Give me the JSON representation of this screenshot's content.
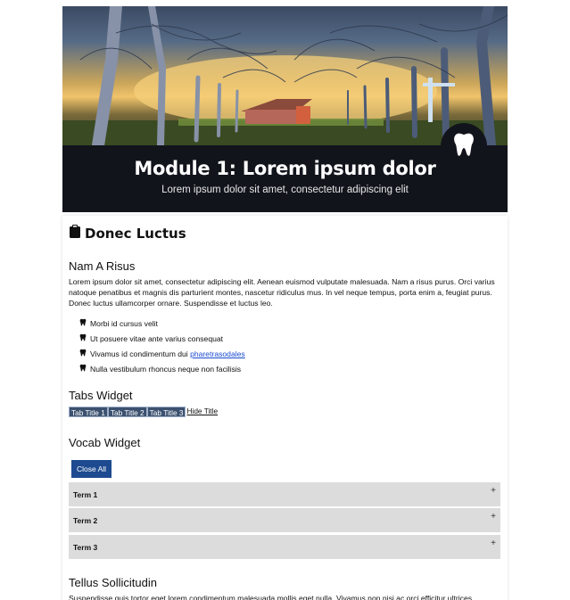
{
  "header": {
    "title": "Module 1: Lorem ipsum dolor",
    "subtitle": "Lorem ipsum dolor sit amet, consectetur adipiscing elit",
    "badge_icon": "tooth-icon"
  },
  "section": {
    "heading": "Donec Luctus",
    "heading_icon": "clipboard-icon"
  },
  "intro": {
    "title": "Nam A Risus",
    "paragraph": "Lorem ipsum dolor sit amet, consectetur adipiscing elit. Aenean euismod vulputate malesuada. Nam a risus purus. Orci varius natoque penatibus et magnis dis parturient montes, nascetur ridiculus mus. In vel neque tempus, porta enim a, feugiat purus. Donec luctus ullamcorper ornare. Suspendisse et luctus leo.",
    "bullets": [
      {
        "text": "Morbi id cursus velit"
      },
      {
        "text": "Ut posuere vitae ante varius consequat"
      },
      {
        "text": "Vivamus id condimentum dui ",
        "link": "pharetrasodales"
      },
      {
        "text": "Nulla vestibulum rhoncus neque non facilisis"
      }
    ],
    "bullet_icon": "tooth-icon"
  },
  "tabs_widget": {
    "title": "Tabs Widget",
    "tabs": [
      "Tab Title 1",
      "Tab Title 2",
      "Tab Title 3"
    ],
    "hide_label": "Hide Title"
  },
  "vocab_widget": {
    "title": "Vocab Widget",
    "close_all_label": "Close All",
    "terms": [
      "Term 1",
      "Term 2",
      "Term 3"
    ],
    "expand_symbol": "+"
  },
  "tellus": {
    "title": "Tellus Sollicitudin",
    "paragraph": "Suspendisse quis tortor eget lorem condimentum malesuada mollis eget nulla. Vivamus non nisi ac orci efficitur ultrices."
  },
  "colors": {
    "header_bg": "#12141c",
    "tab_bg": "#3c5170",
    "button_bg": "#1d4a90",
    "term_bg": "#dcdcdc",
    "link": "#1a4bd0"
  }
}
